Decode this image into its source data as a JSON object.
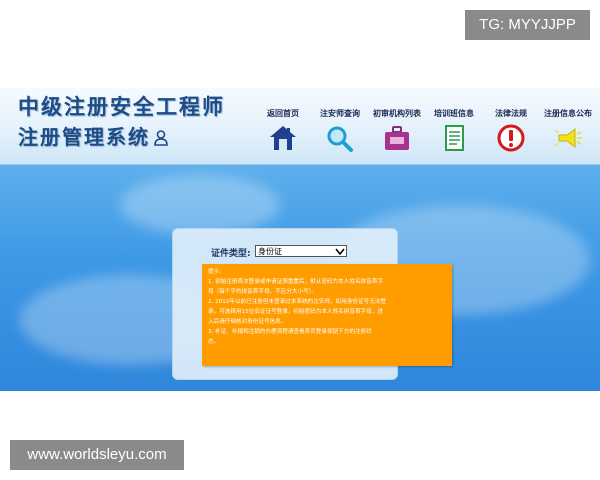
{
  "watermarks": {
    "top_right": "TG: MYYJJPP",
    "bottom_left": "www.worldsleyu.com"
  },
  "header": {
    "title_line1": "中级注册安全工程师",
    "title_line2": "注册管理系统",
    "user_icon": "user-icon"
  },
  "nav": [
    {
      "label": "返回首页",
      "icon": "house-icon"
    },
    {
      "label": "注安师查询",
      "icon": "magnifier-icon"
    },
    {
      "label": "初审机构列表",
      "icon": "briefcase-icon"
    },
    {
      "label": "培训班信息",
      "icon": "document-icon"
    },
    {
      "label": "法律法规",
      "icon": "exclamation-icon"
    },
    {
      "label": "注册信息公布",
      "icon": "megaphone-icon"
    }
  ],
  "login": {
    "cert_type_label": "证件类型:",
    "cert_type_value": "身份证"
  },
  "tips": {
    "title": "提示:",
    "lines": [
      "1. 初始注册首次登录或申请证照重置后，默认密码为本人姓名拼音首字",
      "母（每个字的拼音首字母，不区分大小写）。",
      "2. 2012年以前已注册但未登录过本系统的注安师，如用身份证号无法登",
      "录，可选择用15位旧证证号登录，初始密码为本人姓名拼音首字母，进",
      "入后请仔细核对身份证号信息。",
      "3. 补证、补报和注销的办理流程请查看首页登录按钮下方的注册状",
      "态。"
    ]
  },
  "colors": {
    "header_title": "#1d4b86",
    "banner": "#3f9ae6",
    "tip_bg": "#ff9c00"
  }
}
